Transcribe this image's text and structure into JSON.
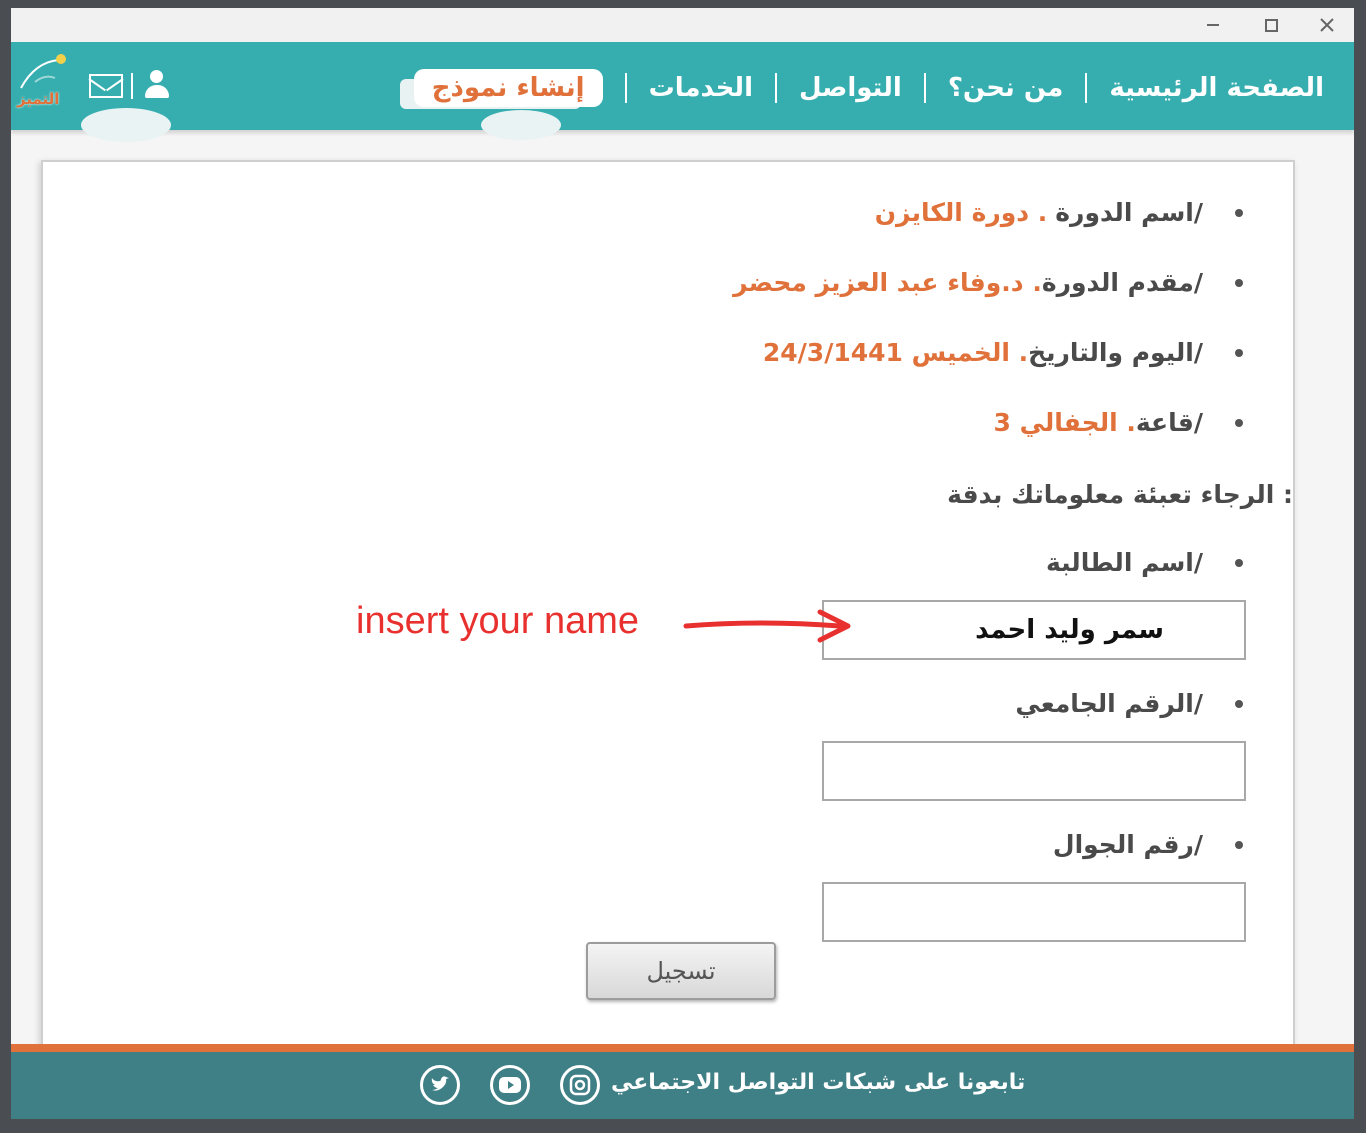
{
  "nav": {
    "home": "الصفحة الرئيسية",
    "about": "من نحن؟",
    "contact": "التواصل",
    "services": "الخدمات",
    "create_form": "إنشاء نموذج"
  },
  "logo_text": "التميز",
  "info": {
    "course_name_label": "اسم الدورة/",
    "course_name_value": "دورة الكايزن .",
    "presenter_label": "مقدم الدورة/",
    "presenter_value": "د.وفاء عبد العزيز محضر .",
    "date_label": "اليوم والتاريخ/",
    "date_value": "الخميس 24/3/1441 .",
    "hall_label": "قاعة/",
    "hall_value": "الجفالي 3 ."
  },
  "instructions": "الرجاء تعبئة معلوماتك بدقة :",
  "form": {
    "student_name_label": "اسم الطالبة/",
    "student_name_value": "سمر وليد احمد",
    "university_id_label": "الرقم الجامعي/",
    "university_id_value": "",
    "mobile_label": "رقم الجوال/",
    "mobile_value": "",
    "submit_label": "تسجيل"
  },
  "annotation": "insert your name",
  "footer": {
    "follow_text": "تابعونا على شبكات التواصل الاجتماعي"
  },
  "colors": {
    "header_teal": "#36aeaf",
    "accent_orange": "#e0713a",
    "footer_teal": "#3f7f86",
    "annotation_red": "#e8312f"
  },
  "icons": [
    "user-icon",
    "mail-icon",
    "instagram-icon",
    "youtube-icon",
    "twitter-icon",
    "minimize-icon",
    "maximize-icon",
    "close-icon"
  ]
}
